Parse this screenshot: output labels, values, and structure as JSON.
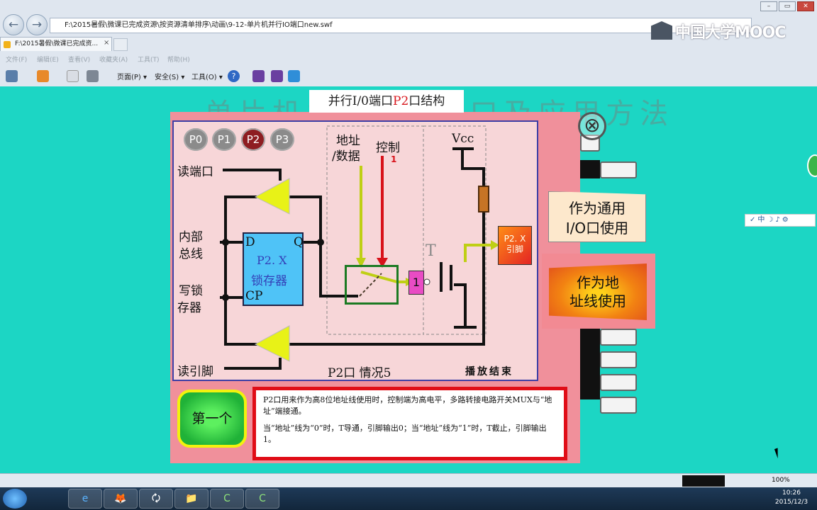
{
  "browser": {
    "address": "F:\\2015暑假\\微课已完成资源\\按资源清单排序\\动画\\9-12-单片机并行IO端口new.swf",
    "tab_title": "F:\\2015暑假\\微课已完成资...",
    "tab_close": "×",
    "back_icon": "←",
    "forward_icon": "→",
    "menu": [
      "文件(F)",
      "编辑(E)",
      "查看(V)",
      "收藏夹(A)",
      "工具(T)",
      "帮助(H)"
    ],
    "toolbar": {
      "page": "页面(P) ▾",
      "safety": "安全(S) ▾",
      "tools": "工具(O) ▾",
      "help_q": "?"
    },
    "logo_text": "中国大学MOOC",
    "win_min": "–",
    "win_max": "▭",
    "win_close": "✕",
    "zoom": "100%",
    "side_toolbar": "✓中☽♪⚙"
  },
  "stage": {
    "background_title": "单片机并行I/O端口及应用方法",
    "panel_title_prefix": "并行I/0端口",
    "panel_title_port": "P2",
    "panel_title_suffix": "口结构",
    "close_icon": "⊗",
    "port_tabs": [
      "P0",
      "P1",
      "P2",
      "P3"
    ],
    "active_port": "P2",
    "labels": {
      "read_port": "读端口",
      "internal_bus_1": "内部",
      "internal_bus_2": "总线",
      "write_latch_1": "写锁",
      "write_latch_2": "存器",
      "read_pin": "读引脚",
      "addr_1": "地址",
      "addr_2": "/数据",
      "control": "控制",
      "control_value": "1",
      "vcc": "Vcc",
      "d": "D",
      "q": "Q",
      "cp": "CP",
      "latch_1": "P2. X",
      "latch_2": "锁存器",
      "inverter": "1",
      "transistor": "T",
      "pin_1": "P2. X",
      "pin_2": "引脚",
      "case": "P2口 情况5",
      "finished": "播放结束"
    },
    "option_general": [
      "作为通用",
      "I/O口使用"
    ],
    "option_address": [
      "作为地",
      "址线使用"
    ],
    "first_button": "第一个",
    "description": [
      "P2口用来作为高8位地址线使用时，控制端为高电平，多路转接电路开关MUX与“地址”端接通。",
      "当“地址”线为“0”时，T导通，引脚输出0；当“地址”线为“1”时，T截止，引脚输出1。"
    ]
  },
  "taskbar": {
    "time": "10:26",
    "date": "2015/12/3",
    "apps": [
      "e",
      "🦊",
      "🗘",
      "📁",
      "C",
      "C"
    ]
  },
  "colors": {
    "stage_bg": "#1cd6c4",
    "frame": "#f0909b",
    "accent_red": "#e00d17"
  }
}
